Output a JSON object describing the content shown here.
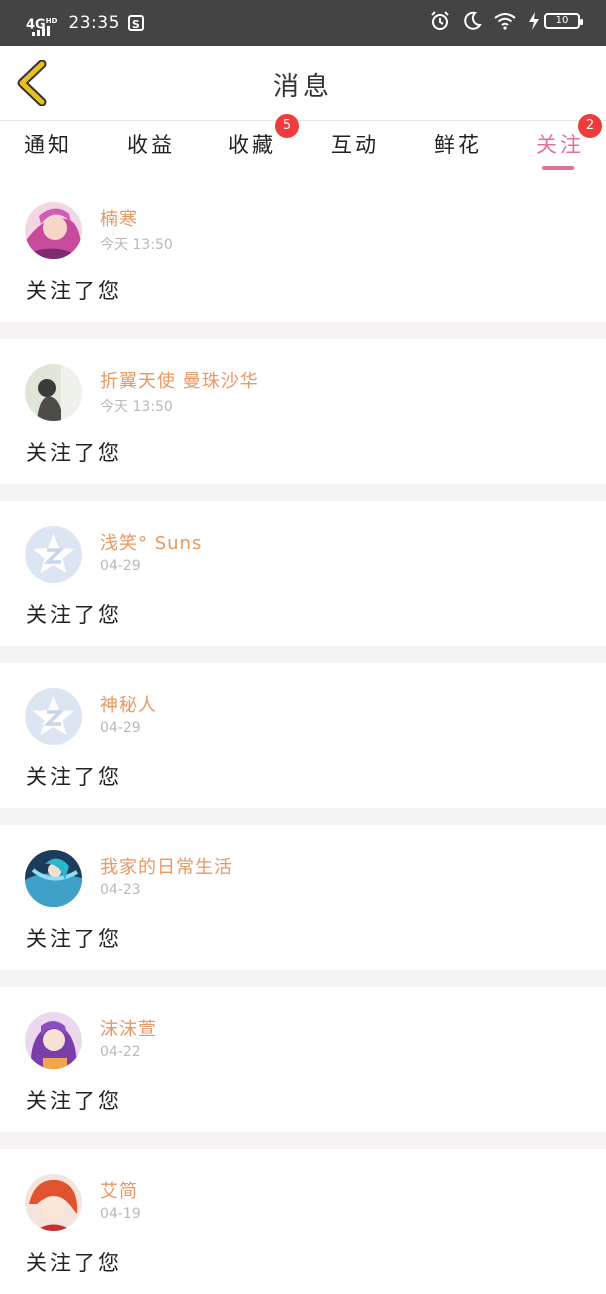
{
  "status_bar": {
    "network": "4G",
    "network_sup": "HD",
    "time": "23:35",
    "s_icon": "S",
    "battery": "10"
  },
  "header": {
    "title": "消息"
  },
  "tabs": [
    {
      "label": "通知",
      "badge": ""
    },
    {
      "label": "收益",
      "badge": ""
    },
    {
      "label": "收藏",
      "badge": "5"
    },
    {
      "label": "互动",
      "badge": ""
    },
    {
      "label": "鲜花",
      "badge": ""
    },
    {
      "label": "关注",
      "badge": "2",
      "active": true
    }
  ],
  "items": [
    {
      "name": "楠寒",
      "time": "今天 13:50",
      "message": "关注了您",
      "avatar": "anime-pink-avatar"
    },
    {
      "name": "折翼天使 曼珠沙华",
      "time": "今天 13:50",
      "message": "关注了您",
      "avatar": "girl-photo-avatar"
    },
    {
      "name": "浅笑° Suns",
      "time": "04-29",
      "message": "关注了您",
      "avatar": "default-star-avatar"
    },
    {
      "name": "神秘人",
      "time": "04-29",
      "message": "关注了您",
      "avatar": "default-star-avatar"
    },
    {
      "name": "我家的日常生活",
      "time": "04-23",
      "message": "关注了您",
      "avatar": "anime-blue-avatar"
    },
    {
      "name": "沫沫萱",
      "time": "04-22",
      "message": "关注了您",
      "avatar": "anime-purple-avatar"
    },
    {
      "name": "艾简",
      "time": "04-19",
      "message": "关注了您",
      "avatar": "anime-red-avatar"
    }
  ],
  "colors": {
    "accent": "#e2729a",
    "name": "#ea9763",
    "badge": "#ef3b3b",
    "back_arrow": "#e8c020"
  }
}
